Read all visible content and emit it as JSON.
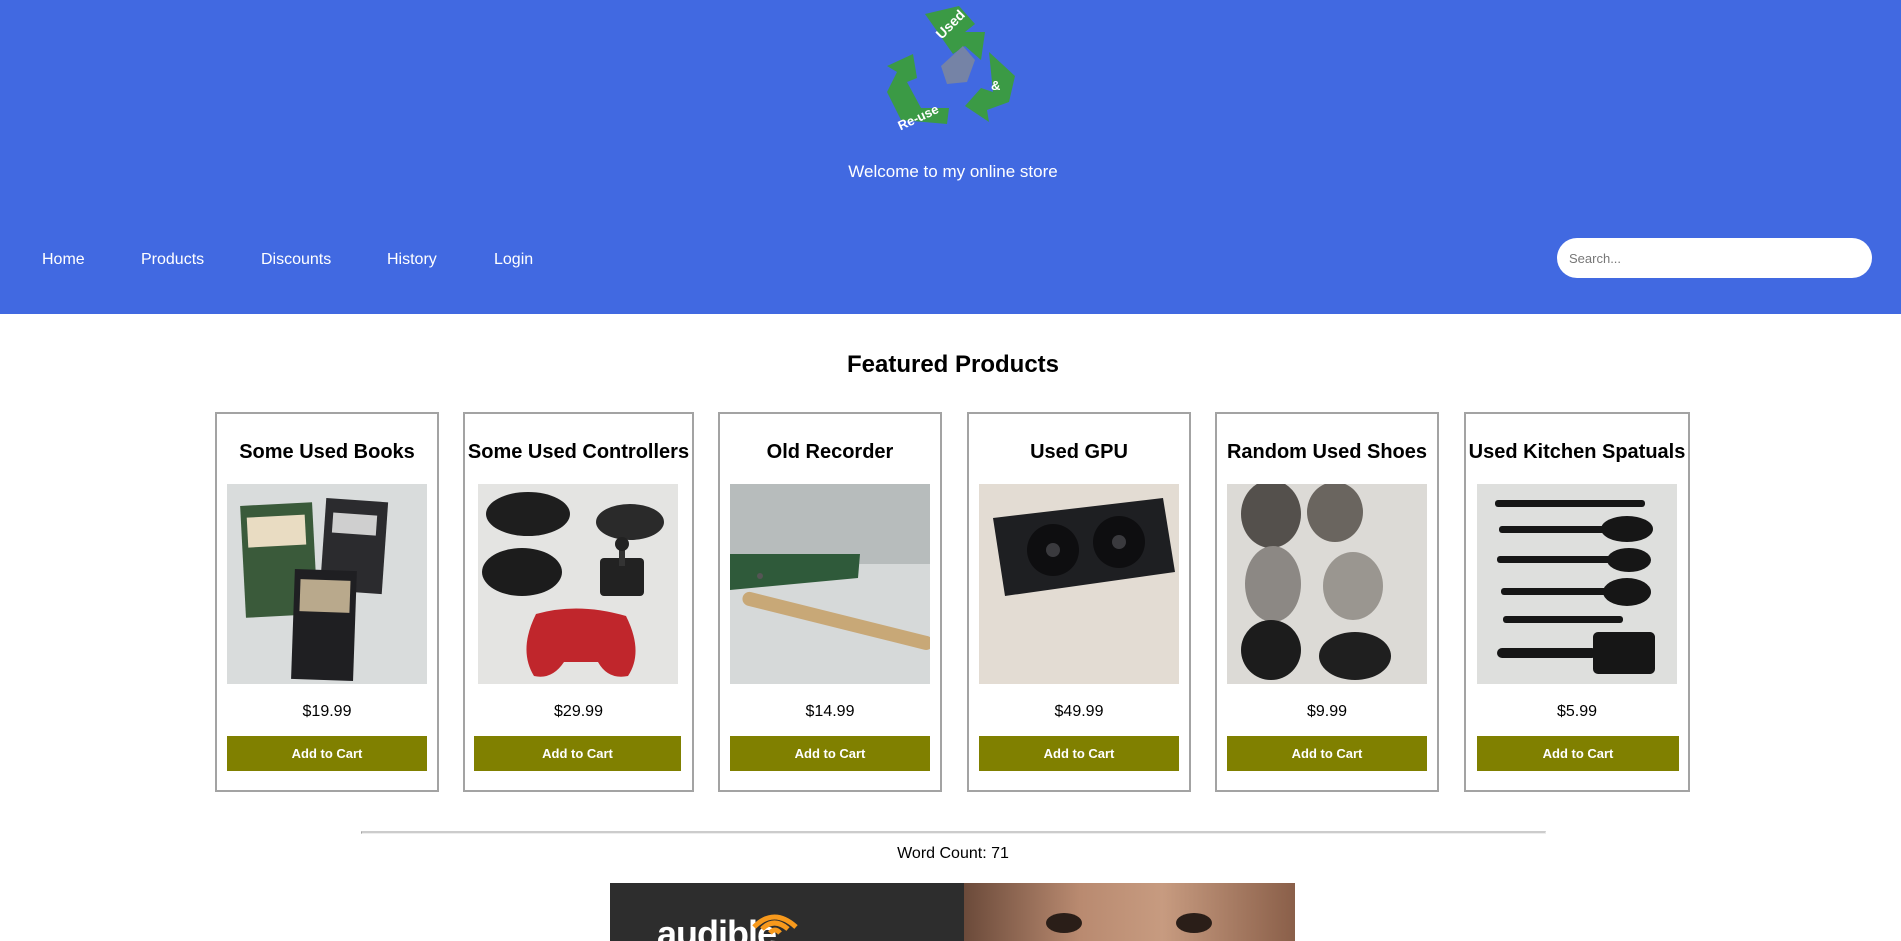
{
  "header": {
    "logo": {
      "text_top": "Used",
      "text_right": "&",
      "text_left": "Re-use",
      "color": "#3b9a45"
    },
    "welcome": "Welcome to my online store",
    "background": "#4169e1"
  },
  "nav": {
    "items": [
      {
        "label": "Home"
      },
      {
        "label": "Products"
      },
      {
        "label": "Discounts"
      },
      {
        "label": "History"
      },
      {
        "label": "Login"
      }
    ]
  },
  "search": {
    "placeholder": "Search...",
    "value": ""
  },
  "main": {
    "title": "Featured Products",
    "products": [
      {
        "name": "Some Used Books",
        "price": "$19.99",
        "button": "Add to Cart",
        "image": "books-photo"
      },
      {
        "name": "Some Used Controllers",
        "price": "$29.99",
        "button": "Add to Cart",
        "image": "controllers-photo"
      },
      {
        "name": "Old Recorder",
        "price": "$14.99",
        "button": "Add to Cart",
        "image": "recorder-photo"
      },
      {
        "name": "Used GPU",
        "price": "$49.99",
        "button": "Add to Cart",
        "image": "gpu-photo"
      },
      {
        "name": "Random Used Shoes",
        "price": "$9.99",
        "button": "Add to Cart",
        "image": "shoes-photo"
      },
      {
        "name": "Used Kitchen Spatuals",
        "price": "$5.99",
        "button": "Add to Cart",
        "image": "spatulas-photo"
      }
    ],
    "button_color": "#808000"
  },
  "footer": {
    "word_count": "Word Count: 71",
    "ad": {
      "brand": "audible"
    }
  }
}
